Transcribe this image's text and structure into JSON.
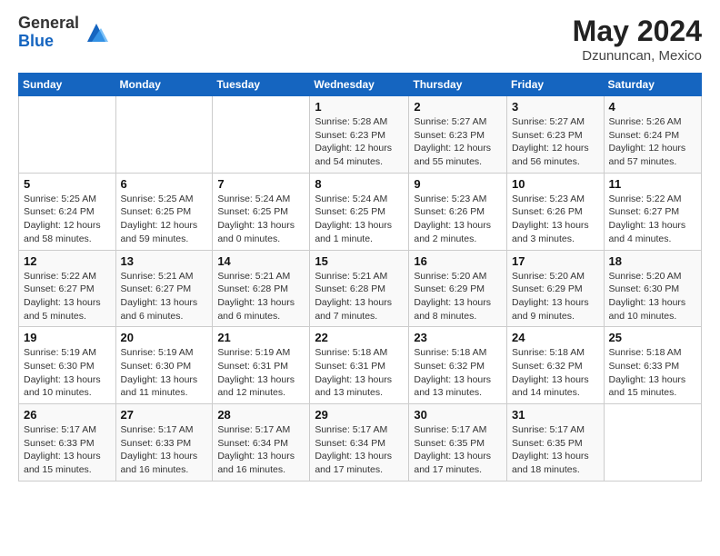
{
  "header": {
    "logo_general": "General",
    "logo_blue": "Blue",
    "month_year": "May 2024",
    "location": "Dzununcan, Mexico"
  },
  "days_of_week": [
    "Sunday",
    "Monday",
    "Tuesday",
    "Wednesday",
    "Thursday",
    "Friday",
    "Saturday"
  ],
  "weeks": [
    [
      {
        "day": "",
        "info": ""
      },
      {
        "day": "",
        "info": ""
      },
      {
        "day": "",
        "info": ""
      },
      {
        "day": "1",
        "info": "Sunrise: 5:28 AM\nSunset: 6:23 PM\nDaylight: 12 hours\nand 54 minutes."
      },
      {
        "day": "2",
        "info": "Sunrise: 5:27 AM\nSunset: 6:23 PM\nDaylight: 12 hours\nand 55 minutes."
      },
      {
        "day": "3",
        "info": "Sunrise: 5:27 AM\nSunset: 6:23 PM\nDaylight: 12 hours\nand 56 minutes."
      },
      {
        "day": "4",
        "info": "Sunrise: 5:26 AM\nSunset: 6:24 PM\nDaylight: 12 hours\nand 57 minutes."
      }
    ],
    [
      {
        "day": "5",
        "info": "Sunrise: 5:25 AM\nSunset: 6:24 PM\nDaylight: 12 hours\nand 58 minutes."
      },
      {
        "day": "6",
        "info": "Sunrise: 5:25 AM\nSunset: 6:25 PM\nDaylight: 12 hours\nand 59 minutes."
      },
      {
        "day": "7",
        "info": "Sunrise: 5:24 AM\nSunset: 6:25 PM\nDaylight: 13 hours\nand 0 minutes."
      },
      {
        "day": "8",
        "info": "Sunrise: 5:24 AM\nSunset: 6:25 PM\nDaylight: 13 hours\nand 1 minute."
      },
      {
        "day": "9",
        "info": "Sunrise: 5:23 AM\nSunset: 6:26 PM\nDaylight: 13 hours\nand 2 minutes."
      },
      {
        "day": "10",
        "info": "Sunrise: 5:23 AM\nSunset: 6:26 PM\nDaylight: 13 hours\nand 3 minutes."
      },
      {
        "day": "11",
        "info": "Sunrise: 5:22 AM\nSunset: 6:27 PM\nDaylight: 13 hours\nand 4 minutes."
      }
    ],
    [
      {
        "day": "12",
        "info": "Sunrise: 5:22 AM\nSunset: 6:27 PM\nDaylight: 13 hours\nand 5 minutes."
      },
      {
        "day": "13",
        "info": "Sunrise: 5:21 AM\nSunset: 6:27 PM\nDaylight: 13 hours\nand 6 minutes."
      },
      {
        "day": "14",
        "info": "Sunrise: 5:21 AM\nSunset: 6:28 PM\nDaylight: 13 hours\nand 6 minutes."
      },
      {
        "day": "15",
        "info": "Sunrise: 5:21 AM\nSunset: 6:28 PM\nDaylight: 13 hours\nand 7 minutes."
      },
      {
        "day": "16",
        "info": "Sunrise: 5:20 AM\nSunset: 6:29 PM\nDaylight: 13 hours\nand 8 minutes."
      },
      {
        "day": "17",
        "info": "Sunrise: 5:20 AM\nSunset: 6:29 PM\nDaylight: 13 hours\nand 9 minutes."
      },
      {
        "day": "18",
        "info": "Sunrise: 5:20 AM\nSunset: 6:30 PM\nDaylight: 13 hours\nand 10 minutes."
      }
    ],
    [
      {
        "day": "19",
        "info": "Sunrise: 5:19 AM\nSunset: 6:30 PM\nDaylight: 13 hours\nand 10 minutes."
      },
      {
        "day": "20",
        "info": "Sunrise: 5:19 AM\nSunset: 6:30 PM\nDaylight: 13 hours\nand 11 minutes."
      },
      {
        "day": "21",
        "info": "Sunrise: 5:19 AM\nSunset: 6:31 PM\nDaylight: 13 hours\nand 12 minutes."
      },
      {
        "day": "22",
        "info": "Sunrise: 5:18 AM\nSunset: 6:31 PM\nDaylight: 13 hours\nand 13 minutes."
      },
      {
        "day": "23",
        "info": "Sunrise: 5:18 AM\nSunset: 6:32 PM\nDaylight: 13 hours\nand 13 minutes."
      },
      {
        "day": "24",
        "info": "Sunrise: 5:18 AM\nSunset: 6:32 PM\nDaylight: 13 hours\nand 14 minutes."
      },
      {
        "day": "25",
        "info": "Sunrise: 5:18 AM\nSunset: 6:33 PM\nDaylight: 13 hours\nand 15 minutes."
      }
    ],
    [
      {
        "day": "26",
        "info": "Sunrise: 5:17 AM\nSunset: 6:33 PM\nDaylight: 13 hours\nand 15 minutes."
      },
      {
        "day": "27",
        "info": "Sunrise: 5:17 AM\nSunset: 6:33 PM\nDaylight: 13 hours\nand 16 minutes."
      },
      {
        "day": "28",
        "info": "Sunrise: 5:17 AM\nSunset: 6:34 PM\nDaylight: 13 hours\nand 16 minutes."
      },
      {
        "day": "29",
        "info": "Sunrise: 5:17 AM\nSunset: 6:34 PM\nDaylight: 13 hours\nand 17 minutes."
      },
      {
        "day": "30",
        "info": "Sunrise: 5:17 AM\nSunset: 6:35 PM\nDaylight: 13 hours\nand 17 minutes."
      },
      {
        "day": "31",
        "info": "Sunrise: 5:17 AM\nSunset: 6:35 PM\nDaylight: 13 hours\nand 18 minutes."
      },
      {
        "day": "",
        "info": ""
      }
    ]
  ]
}
